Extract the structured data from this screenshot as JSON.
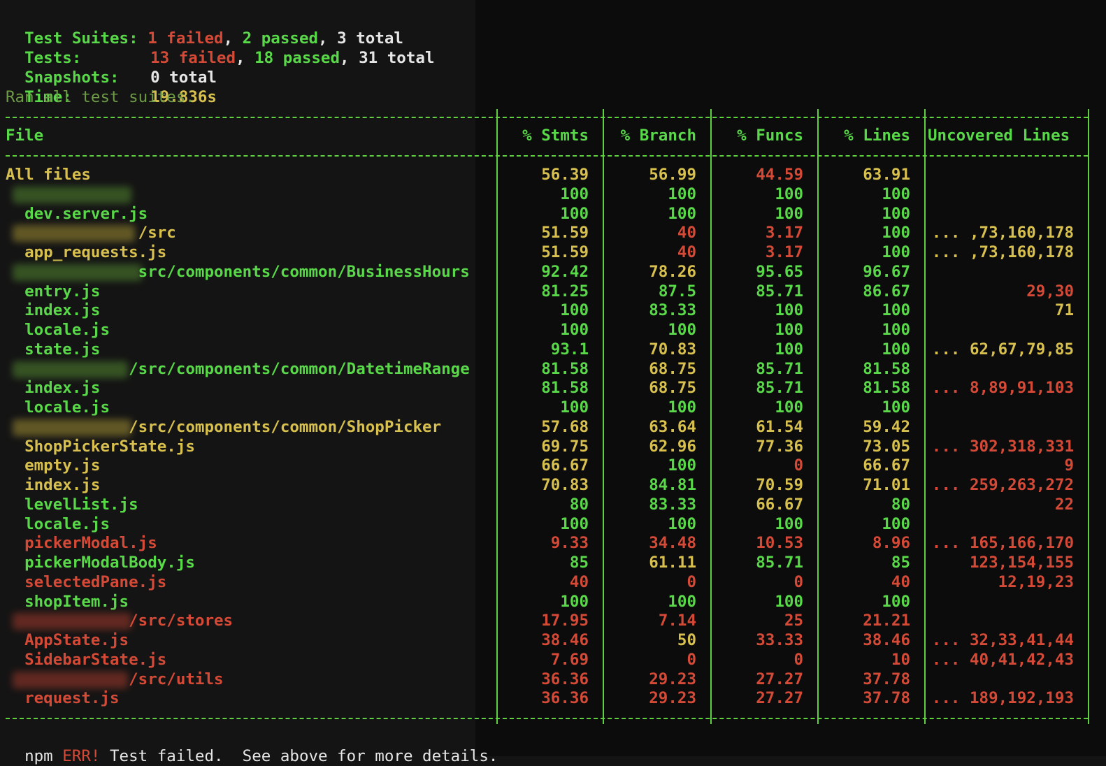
{
  "summary": {
    "suites_label": "Test Suites:",
    "suites_failed": "1 failed",
    "suites_passed": "2 passed",
    "suites_total": "3 total",
    "tests_label": "Tests:",
    "tests_failed": "13 failed",
    "tests_passed": "18 passed",
    "tests_total": "31 total",
    "snapshots_label": "Snapshots:",
    "snapshots_value": "0 total",
    "time_label": "Time:",
    "time_value": "19.836s",
    "ran_all": "Ran all test suites."
  },
  "table": {
    "headers": [
      "File",
      "% Stmts",
      "% Branch",
      "% Funcs",
      "% Lines",
      "Uncovered Lines"
    ],
    "rows": [
      {
        "file": "All files",
        "c": "y",
        "vals": [
          "56.39",
          "56.99",
          "44.59",
          "63.91"
        ],
        "vc": [
          "y",
          "y",
          "r",
          "y"
        ],
        "unc": "",
        "uc": "g"
      },
      {
        "file": "",
        "c": "g",
        "vals": [
          "100",
          "100",
          "100",
          "100"
        ],
        "vc": [
          "g",
          "g",
          "g",
          "g"
        ],
        "unc": "",
        "uc": "g",
        "blurw": 170,
        "blurc": ""
      },
      {
        "file": "  dev.server.js",
        "c": "g",
        "vals": [
          "100",
          "100",
          "100",
          "100"
        ],
        "vc": [
          "g",
          "g",
          "g",
          "g"
        ],
        "unc": "",
        "uc": "g"
      },
      {
        "file": "              /src",
        "c": "y",
        "vals": [
          "51.59",
          "40",
          "3.17",
          "100"
        ],
        "vc": [
          "y",
          "r",
          "r",
          "g"
        ],
        "unc": "... ,73,160,178",
        "uc": "y",
        "blurw": 175,
        "blurc": "yel"
      },
      {
        "file": "  app_requests.js",
        "c": "y",
        "vals": [
          "51.59",
          "40",
          "3.17",
          "100"
        ],
        "vc": [
          "y",
          "r",
          "r",
          "g"
        ],
        "unc": "... ,73,160,178",
        "uc": "y"
      },
      {
        "file": "              src/components/common/BusinessHours",
        "c": "g",
        "vals": [
          "92.42",
          "78.26",
          "95.65",
          "96.67"
        ],
        "vc": [
          "g",
          "y",
          "g",
          "g"
        ],
        "unc": "",
        "uc": "g",
        "blurw": 185,
        "blurc": ""
      },
      {
        "file": "  entry.js",
        "c": "g",
        "vals": [
          "81.25",
          "87.5",
          "85.71",
          "86.67"
        ],
        "vc": [
          "g",
          "g",
          "g",
          "g"
        ],
        "unc": "29,30",
        "uc": "r"
      },
      {
        "file": "  index.js",
        "c": "g",
        "vals": [
          "100",
          "83.33",
          "100",
          "100"
        ],
        "vc": [
          "g",
          "g",
          "g",
          "g"
        ],
        "unc": "71",
        "uc": "y"
      },
      {
        "file": "  locale.js",
        "c": "g",
        "vals": [
          "100",
          "100",
          "100",
          "100"
        ],
        "vc": [
          "g",
          "g",
          "g",
          "g"
        ],
        "unc": "",
        "uc": "g"
      },
      {
        "file": "  state.js",
        "c": "g",
        "vals": [
          "93.1",
          "70.83",
          "100",
          "100"
        ],
        "vc": [
          "g",
          "y",
          "g",
          "g"
        ],
        "unc": "... 62,67,79,85",
        "uc": "y"
      },
      {
        "file": "             /src/components/common/DatetimeRange",
        "c": "g",
        "vals": [
          "81.58",
          "68.75",
          "85.71",
          "81.58"
        ],
        "vc": [
          "g",
          "y",
          "g",
          "g"
        ],
        "unc": "",
        "uc": "g",
        "blurw": 165,
        "blurc": ""
      },
      {
        "file": "  index.js",
        "c": "g",
        "vals": [
          "81.58",
          "68.75",
          "85.71",
          "81.58"
        ],
        "vc": [
          "g",
          "y",
          "g",
          "g"
        ],
        "unc": "... 8,89,91,103",
        "uc": "r"
      },
      {
        "file": "  locale.js",
        "c": "g",
        "vals": [
          "100",
          "100",
          "100",
          "100"
        ],
        "vc": [
          "g",
          "g",
          "g",
          "g"
        ],
        "unc": "",
        "uc": "g"
      },
      {
        "file": "             /src/components/common/ShopPicker",
        "c": "y",
        "vals": [
          "57.68",
          "63.64",
          "61.54",
          "59.42"
        ],
        "vc": [
          "y",
          "y",
          "y",
          "y"
        ],
        "unc": "",
        "uc": "g",
        "blurw": 170,
        "blurc": "yel"
      },
      {
        "file": "  ShopPickerState.js",
        "c": "y",
        "vals": [
          "69.75",
          "62.96",
          "77.36",
          "73.05"
        ],
        "vc": [
          "y",
          "y",
          "y",
          "y"
        ],
        "unc": "... 302,318,331",
        "uc": "r"
      },
      {
        "file": "  empty.js",
        "c": "y",
        "vals": [
          "66.67",
          "100",
          "0",
          "66.67"
        ],
        "vc": [
          "y",
          "g",
          "r",
          "y"
        ],
        "unc": "9",
        "uc": "r"
      },
      {
        "file": "  index.js",
        "c": "y",
        "vals": [
          "70.83",
          "84.81",
          "70.59",
          "71.01"
        ],
        "vc": [
          "y",
          "g",
          "y",
          "y"
        ],
        "unc": "... 259,263,272",
        "uc": "r"
      },
      {
        "file": "  levelList.js",
        "c": "g",
        "vals": [
          "80",
          "83.33",
          "66.67",
          "80"
        ],
        "vc": [
          "g",
          "g",
          "y",
          "g"
        ],
        "unc": "22",
        "uc": "r"
      },
      {
        "file": "  locale.js",
        "c": "g",
        "vals": [
          "100",
          "100",
          "100",
          "100"
        ],
        "vc": [
          "g",
          "g",
          "g",
          "g"
        ],
        "unc": "",
        "uc": "g"
      },
      {
        "file": "  pickerModal.js",
        "c": "r",
        "vals": [
          "9.33",
          "34.48",
          "10.53",
          "8.96"
        ],
        "vc": [
          "r",
          "r",
          "r",
          "r"
        ],
        "unc": "... 165,166,170",
        "uc": "r"
      },
      {
        "file": "  pickerModalBody.js",
        "c": "g",
        "vals": [
          "85",
          "61.11",
          "85.71",
          "85"
        ],
        "vc": [
          "g",
          "y",
          "g",
          "g"
        ],
        "unc": "123,154,155",
        "uc": "r"
      },
      {
        "file": "  selectedPane.js",
        "c": "r",
        "vals": [
          "40",
          "0",
          "0",
          "40"
        ],
        "vc": [
          "r",
          "r",
          "r",
          "r"
        ],
        "unc": "12,19,23",
        "uc": "r"
      },
      {
        "file": "  shopItem.js",
        "c": "g",
        "vals": [
          "100",
          "100",
          "100",
          "100"
        ],
        "vc": [
          "g",
          "g",
          "g",
          "g"
        ],
        "unc": "",
        "uc": "g"
      },
      {
        "file": "             /src/stores",
        "c": "r",
        "vals": [
          "17.95",
          "7.14",
          "25",
          "21.21"
        ],
        "vc": [
          "r",
          "r",
          "r",
          "r"
        ],
        "unc": "",
        "uc": "g",
        "blurw": 170,
        "blurc": "red"
      },
      {
        "file": "  AppState.js",
        "c": "r",
        "vals": [
          "38.46",
          "50",
          "33.33",
          "38.46"
        ],
        "vc": [
          "r",
          "y",
          "r",
          "r"
        ],
        "unc": "... 32,33,41,44",
        "uc": "r"
      },
      {
        "file": "  SidebarState.js",
        "c": "r",
        "vals": [
          "7.69",
          "0",
          "0",
          "10"
        ],
        "vc": [
          "r",
          "r",
          "r",
          "r"
        ],
        "unc": "... 40,41,42,43",
        "uc": "r"
      },
      {
        "file": "             /src/utils",
        "c": "r",
        "vals": [
          "36.36",
          "29.23",
          "27.27",
          "37.78"
        ],
        "vc": [
          "r",
          "r",
          "r",
          "r"
        ],
        "unc": "",
        "uc": "g",
        "blurw": 165,
        "blurc": "red"
      },
      {
        "file": "  request.js",
        "c": "r",
        "vals": [
          "36.36",
          "29.23",
          "27.27",
          "37.78"
        ],
        "vc": [
          "r",
          "r",
          "r",
          "r"
        ],
        "unc": "... 189,192,193",
        "uc": "r"
      }
    ]
  },
  "footer": {
    "npm": "npm",
    "err": "ERR!",
    "message": "Test failed.  See above for more details."
  },
  "colors": {
    "green": "#59d849",
    "red": "#d54a37",
    "yellow": "#d8c04f",
    "white": "#e6e6e6"
  }
}
